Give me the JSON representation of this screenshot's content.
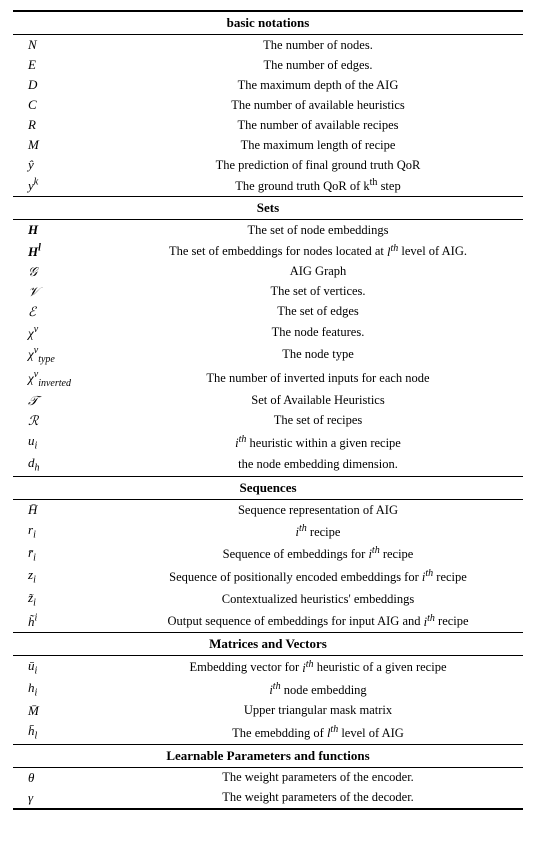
{
  "table": {
    "sections": [
      {
        "header": "basic notations",
        "header_style": "first",
        "rows": [
          {
            "symbol": "N",
            "symbol_italic": true,
            "description": "The number of nodes."
          },
          {
            "symbol": "E",
            "symbol_italic": true,
            "description": "The number of edges."
          },
          {
            "symbol": "D",
            "symbol_italic": true,
            "description": "The maximum depth of the AIG"
          },
          {
            "symbol": "C",
            "symbol_italic": true,
            "description": "The number of available heuristics"
          },
          {
            "symbol": "R",
            "symbol_italic": true,
            "description": "The number of available recipes"
          },
          {
            "symbol": "M",
            "symbol_italic": true,
            "description": "The maximum length of recipe"
          },
          {
            "symbol": "ŷ",
            "symbol_italic": true,
            "description": "The prediction of final ground truth QoR"
          },
          {
            "symbol": "y^k",
            "symbol_italic": true,
            "description": "The ground truth QoR of k^th step"
          }
        ]
      },
      {
        "header": "Sets",
        "header_style": "normal",
        "rows": [
          {
            "symbol": "H",
            "symbol_bold": true,
            "description": "The set of node embeddings"
          },
          {
            "symbol": "H^l",
            "symbol_bold": true,
            "description": "The set of embeddings for nodes located at l^th level of AIG."
          },
          {
            "symbol": "𝒢",
            "symbol_bold": false,
            "description": "AIG Graph"
          },
          {
            "symbol": "𝒱",
            "symbol_bold": false,
            "description": "The set of vertices."
          },
          {
            "symbol": "ℰ",
            "symbol_bold": false,
            "description": "The set of edges"
          },
          {
            "symbol": "χ^v",
            "symbol_bold": false,
            "description": "The node features."
          },
          {
            "symbol": "χ^v_type",
            "symbol_bold": false,
            "description": "The node type"
          },
          {
            "symbol": "χ^v_inverted",
            "symbol_bold": false,
            "description": "The number of inverted inputs for each node"
          },
          {
            "symbol": "𝒯",
            "symbol_bold": false,
            "description": "Set of Available Heuristics"
          },
          {
            "symbol": "ℛ",
            "symbol_bold": false,
            "description": "The set of recipes"
          },
          {
            "symbol": "u_i",
            "symbol_bold": false,
            "description": "i^th heuristic within a given recipe"
          },
          {
            "symbol": "d_h",
            "symbol_bold": false,
            "description": "the node embedding dimension."
          }
        ]
      },
      {
        "header": "Sequences",
        "header_style": "normal",
        "rows": [
          {
            "symbol": "H̄",
            "symbol_bold": false,
            "description": "Sequence representation of AIG"
          },
          {
            "symbol": "r_i",
            "symbol_bold": false,
            "description": "i^th recipe"
          },
          {
            "symbol": "r̄_i",
            "symbol_bold": false,
            "description": "Sequence of embeddings for i^th recipe"
          },
          {
            "symbol": "z_i",
            "symbol_bold": false,
            "description": "Sequence of positionally encoded embeddings for i^th recipe"
          },
          {
            "symbol": "z̃_i",
            "symbol_bold": false,
            "description": "Contextualized heuristics' embeddings"
          },
          {
            "symbol": "h̃^i",
            "symbol_bold": false,
            "description": "Output sequence of embeddings for input AIG and i^th recipe"
          }
        ]
      },
      {
        "header": "Matrices and Vectors",
        "header_style": "normal",
        "rows": [
          {
            "symbol": "ū_i",
            "symbol_bold": false,
            "description": "Embedding vector for i^th heuristic of a given recipe"
          },
          {
            "symbol": "h_i",
            "symbol_bold": false,
            "description": "i^th node embedding"
          },
          {
            "symbol": "M̄",
            "symbol_bold": false,
            "description": "Upper triangular mask matrix"
          },
          {
            "symbol": "h̄_l",
            "symbol_bold": false,
            "description": "The emebdding of l^th level of AIG"
          }
        ]
      },
      {
        "header": "Learnable Parameters and functions",
        "header_style": "normal",
        "rows": [
          {
            "symbol": "θ",
            "symbol_bold": false,
            "description": "The weight parameters of the encoder."
          },
          {
            "symbol": "γ",
            "symbol_bold": false,
            "description": "The weight parameters of the decoder."
          }
        ]
      }
    ]
  }
}
